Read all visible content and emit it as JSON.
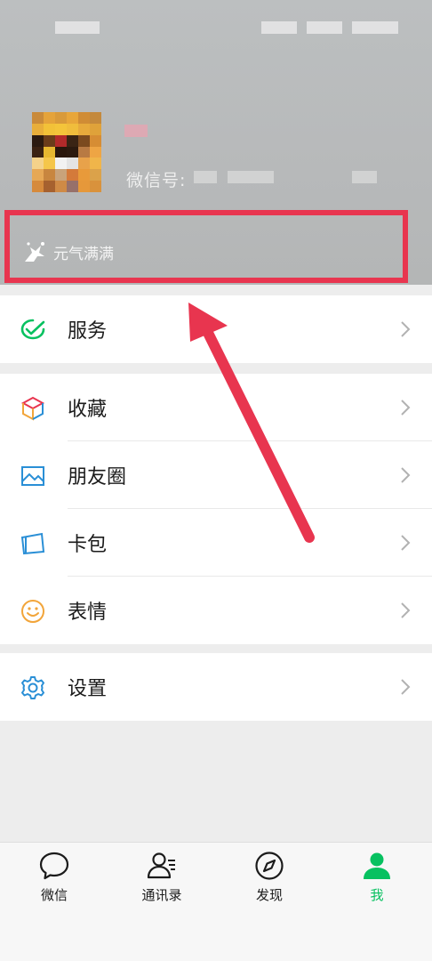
{
  "profile": {
    "wechat_id_label": "微信号:",
    "status_text": "元气满满"
  },
  "menu": {
    "services": "服务",
    "favorites": "收藏",
    "moments": "朋友圈",
    "cards": "卡包",
    "stickers": "表情",
    "settings": "设置"
  },
  "tabbar": {
    "chats": "微信",
    "contacts": "通讯录",
    "discover": "发现",
    "me": "我"
  },
  "colors": {
    "accent": "#07c160",
    "highlight": "#e8354f",
    "favorites_icon": "#f2a53a",
    "moments_icon": "#2a8fd6",
    "cards_icon": "#2a8fd6",
    "stickers_icon": "#f2a53a",
    "settings_icon": "#2a8fd6"
  },
  "icons": {
    "services": "wechat-pay-icon",
    "favorites": "cube-icon",
    "moments": "picture-icon",
    "cards": "card-icon",
    "stickers": "smiley-icon",
    "settings": "gear-icon"
  }
}
